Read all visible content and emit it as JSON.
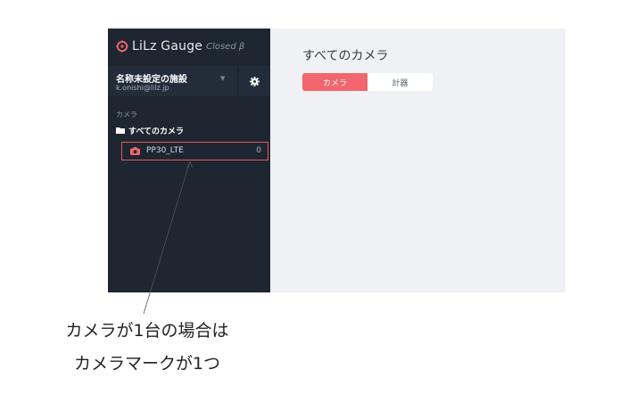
{
  "app": {
    "brand_name": "LiLz Gauge",
    "brand_tag": "Closed β"
  },
  "facility": {
    "name": "名称未設定の施設",
    "email": "k.onishi@lilz.jp"
  },
  "sidebar": {
    "section_label": "カメラ",
    "folder_label": "すべてのカメラ",
    "cameras": [
      {
        "name": "PP30_LTE",
        "count": "0"
      }
    ]
  },
  "main": {
    "title": "すべてのカメラ",
    "tabs": [
      {
        "label": "カメラ",
        "active": true
      },
      {
        "label": "計器",
        "active": false
      }
    ]
  },
  "annotation": {
    "line1": "カメラが1台の場合は",
    "line2": "カメラマークが1つ"
  },
  "colors": {
    "sidebar_bg": "#1d2631",
    "accent": "#f2666d",
    "highlight_border": "#e35a5f",
    "content_bg": "#f0f1f4"
  },
  "icons": {
    "brand": "lilz-logo-icon",
    "settings": "gear-icon",
    "folder": "folder-icon",
    "camera": "camera-icon",
    "dropdown": "caret-down-icon"
  }
}
